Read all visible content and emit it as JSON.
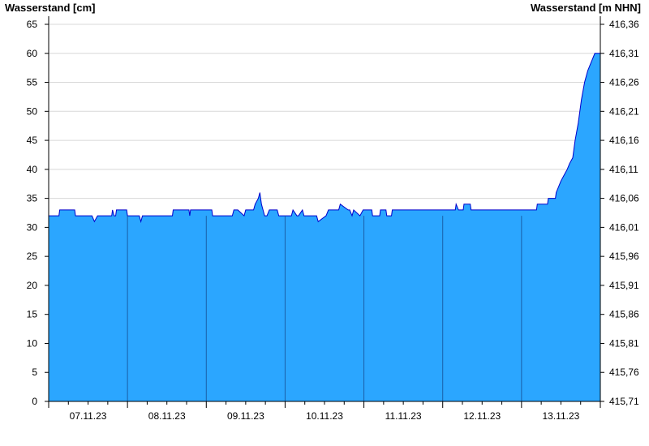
{
  "chart_data": {
    "type": "area",
    "left_axis_title": "Wasserstand [cm]",
    "right_axis_title": "Wasserstand [m NHN]",
    "y_left": {
      "min": 0,
      "max": 65,
      "ticks": [
        0,
        5,
        10,
        15,
        20,
        25,
        30,
        35,
        40,
        45,
        50,
        55,
        60,
        65
      ]
    },
    "y_right": {
      "ticks": [
        "415,71",
        "415,76",
        "415,81",
        "415,86",
        "415,91",
        "415,96",
        "416,01",
        "416,06",
        "416,11",
        "416,16",
        "416,21",
        "416,26",
        "416,31",
        "416,36"
      ]
    },
    "x_range": [
      0,
      7
    ],
    "day_labels": [
      "07.11.23",
      "08.11.23",
      "09.11.23",
      "10.11.23",
      "11.11.23",
      "12.11.23",
      "13.11.23"
    ],
    "grid": "horizontal",
    "fill_color": "#2ba6ff",
    "line_color": "#0000cc",
    "series": [
      {
        "x": [
          0.0,
          0.13,
          0.14,
          0.33,
          0.34,
          0.55,
          0.58,
          0.62,
          0.8,
          0.81,
          0.83,
          0.85,
          0.86,
          0.99,
          1.0,
          1.15,
          1.17,
          1.19,
          1.57,
          1.58,
          1.78,
          1.79,
          1.8,
          2.07,
          2.08,
          2.33,
          2.35,
          2.4,
          2.48,
          2.5,
          2.6,
          2.62,
          2.66,
          2.68,
          2.7,
          2.72,
          2.74,
          2.77,
          2.8,
          2.9,
          2.92,
          3.08,
          3.1,
          3.15,
          3.17,
          3.22,
          3.24,
          3.4,
          3.42,
          3.52,
          3.55,
          3.68,
          3.7,
          3.8,
          3.82,
          3.85,
          3.87,
          3.95,
          3.99,
          4.1,
          4.11,
          4.2,
          4.21,
          4.28,
          4.29,
          4.35,
          4.36,
          4.57,
          4.6,
          5.0,
          5.16,
          5.17,
          5.2,
          5.26,
          5.27,
          5.35,
          5.36,
          5.45,
          5.46,
          5.99,
          6.0,
          6.19,
          6.2,
          6.33,
          6.34,
          6.43,
          6.44,
          6.5,
          6.54,
          6.58,
          6.61,
          6.65,
          6.68,
          6.72,
          6.76,
          6.8,
          6.84,
          6.87,
          6.9,
          6.93,
          6.96,
          7.0
        ],
        "values": [
          32,
          32,
          33,
          33,
          32,
          32,
          31,
          32,
          32,
          33,
          32,
          32,
          33,
          33,
          32,
          32,
          31,
          32,
          32,
          33,
          33,
          32,
          33,
          33,
          32,
          32,
          33,
          33,
          32,
          33,
          33,
          34,
          35,
          36,
          34,
          33,
          32,
          32,
          33,
          33,
          32,
          32,
          33,
          32,
          32,
          33,
          32,
          32,
          31,
          32,
          33,
          33,
          34,
          33,
          33,
          32,
          33,
          32,
          33,
          33,
          32,
          32,
          33,
          33,
          32,
          32,
          33,
          33,
          33,
          33,
          33,
          34,
          33,
          33,
          34,
          34,
          33,
          33,
          33,
          33,
          33,
          33,
          34,
          34,
          35,
          35,
          36,
          38,
          39,
          40,
          41,
          42,
          45,
          48,
          52,
          55,
          57,
          58,
          59,
          60,
          60,
          60
        ]
      }
    ]
  }
}
